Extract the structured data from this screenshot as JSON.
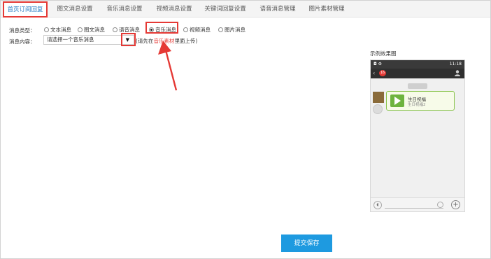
{
  "tabs": [
    {
      "label": "首页订阅回复",
      "active": true
    },
    {
      "label": "图文消息设置"
    },
    {
      "label": "音乐消息设置"
    },
    {
      "label": "视频消息设置"
    },
    {
      "label": "关键词回复设置"
    },
    {
      "label": "语音消息管理"
    },
    {
      "label": "图片素材管理"
    }
  ],
  "form": {
    "type_label": "消息类型：",
    "types": [
      "文本消息",
      "图文消息",
      "语音消息",
      "音乐消息",
      "视频消息",
      "图片消息"
    ],
    "selected_type": "音乐消息",
    "content_label": "消息内容：",
    "select_value": "请选择一个音乐消息",
    "hint_prefix": "(请先在",
    "hint_link": "音乐素材",
    "hint_suffix": "里面上传)"
  },
  "preview": {
    "label": "示例效果图",
    "time": "11:18",
    "badge": "16",
    "music_title": "生日祝福",
    "music_subtitle": "生日祝福2"
  },
  "submit_label": "提交保存",
  "colors": {
    "highlight": "#e53935",
    "accent": "#1e9ae0",
    "bubble_border": "#8ac44c"
  }
}
